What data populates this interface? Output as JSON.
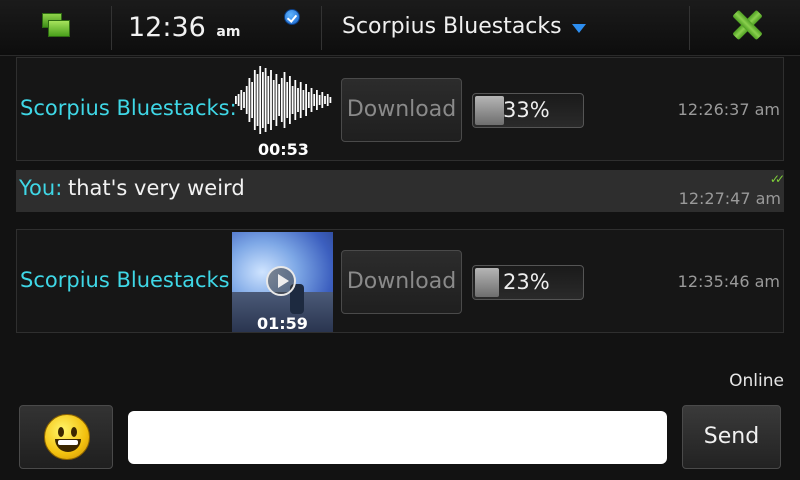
{
  "header": {
    "time": "12:36",
    "ampm": "am",
    "title": "Scorpius Bluestacks"
  },
  "messages": [
    {
      "type": "audio",
      "sender": "Scorpius Bluestacks:",
      "duration": "00:53",
      "download_label": "Download",
      "progress_text": "33%",
      "progress": 0.33,
      "timestamp": "12:26:37 am"
    },
    {
      "type": "text",
      "sender": "You:",
      "body": "that's very weird",
      "timestamp": "12:27:47 am",
      "delivered_icon": "double-check-icon"
    },
    {
      "type": "video",
      "sender": "Scorpius Bluestacks:",
      "duration": "01:59",
      "download_label": "Download",
      "progress_text": "23%",
      "progress": 0.23,
      "timestamp": "12:35:46 am"
    }
  ],
  "composer": {
    "status": "Online",
    "input_value": "",
    "send_label": "Send"
  },
  "colors": {
    "sender": "#3fd7e6",
    "accent_green": "#7fd03a",
    "dropdown_arrow": "#2d8ef0"
  }
}
